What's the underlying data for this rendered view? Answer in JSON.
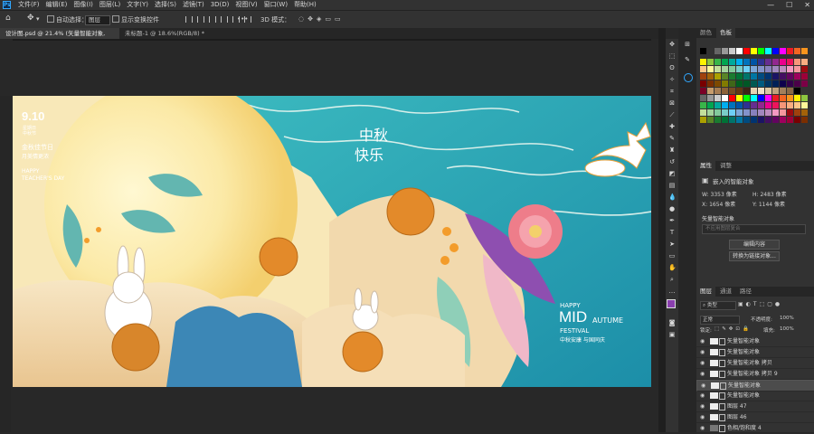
{
  "menubar": {
    "logo": "Ps",
    "items": [
      "文件(F)",
      "编辑(E)",
      "图像(I)",
      "图层(L)",
      "文字(Y)",
      "选择(S)",
      "滤镜(T)",
      "3D(D)",
      "视图(V)",
      "窗口(W)",
      "帮助(H)"
    ],
    "window_controls": [
      "—",
      "☐",
      "✕"
    ]
  },
  "optionsbar": {
    "auto_select_label": "自动选择：",
    "auto_select_value": "图层",
    "show_transform_label": "显示变换控件",
    "mode_3d_label": "3D 模式："
  },
  "tabs": [
    {
      "label": "设计图.psd @ 21.4% (矢量智能对象, RGB/8#) ×",
      "active": true
    },
    {
      "label": "未标题-1 @ 18.6%(RGB/8) * ×",
      "active": false
    }
  ],
  "artwork": {
    "date": "9.10",
    "date_sub1": "星期日",
    "date_sub2": "中秋节",
    "line1": "金秋佳节日",
    "line2": "月美情更浓",
    "happy": "HAPPY",
    "teachers_day": "TEACHER'S DAY",
    "calligraphy1": "中秋",
    "calligraphy2": "快乐",
    "en_happy": "HAPPY",
    "en_mid": "MID",
    "en_autume": "AUTUME",
    "en_festival": "FESTIVAL",
    "cn_slogan": "中秋安康 与国同庆"
  },
  "swatches_panel": {
    "tabs": [
      "颜色",
      "色板"
    ],
    "active_tab": "色板"
  },
  "properties_panel": {
    "tabs": [
      "属性",
      "调整"
    ],
    "title": "嵌入的智能对象",
    "w_label": "W:",
    "w_value": "3353 像素",
    "h_label": "H:",
    "h_value": "2483 像素",
    "x_label": "X:",
    "x_value": "1654 像素",
    "y_label": "Y:",
    "y_value": "1144 像素",
    "object_type": "矢量智能对象",
    "layer_comp_placeholder": "不应用图层复合",
    "edit_button": "编辑内容",
    "convert_button": "转换为链接对象..."
  },
  "layers_panel": {
    "tabs": [
      "图层",
      "通道",
      "路径"
    ],
    "filter_label": "类型",
    "blend_mode": "正常",
    "opacity_label": "不透明度:",
    "opacity_value": "100%",
    "lock_label": "锁定:",
    "fill_label": "填充:",
    "fill_value": "100%",
    "layers": [
      {
        "name": "矢量智能对象",
        "selected": false,
        "kind": "smart"
      },
      {
        "name": "矢量智能对象",
        "selected": false,
        "kind": "smart"
      },
      {
        "name": "矢量智能对象 拷贝",
        "selected": false,
        "kind": "smart"
      },
      {
        "name": "矢量智能对象 拷贝 9",
        "selected": false,
        "kind": "smart"
      },
      {
        "name": "矢量智能对象",
        "selected": true,
        "kind": "smart"
      },
      {
        "name": "矢量智能对象",
        "selected": false,
        "kind": "smart"
      },
      {
        "name": "图层 47",
        "selected": false,
        "kind": "pixel"
      },
      {
        "name": "图层 46",
        "selected": false,
        "kind": "pixel"
      },
      {
        "name": "色相/饱和度 4",
        "selected": false,
        "kind": "adjust"
      }
    ]
  },
  "colors": {
    "accent": "#31a8ff",
    "foreground": "#8a3fae",
    "background": "#ffffff",
    "teal_bg": "#2bb0b8",
    "moon": "#fbe9a6"
  }
}
